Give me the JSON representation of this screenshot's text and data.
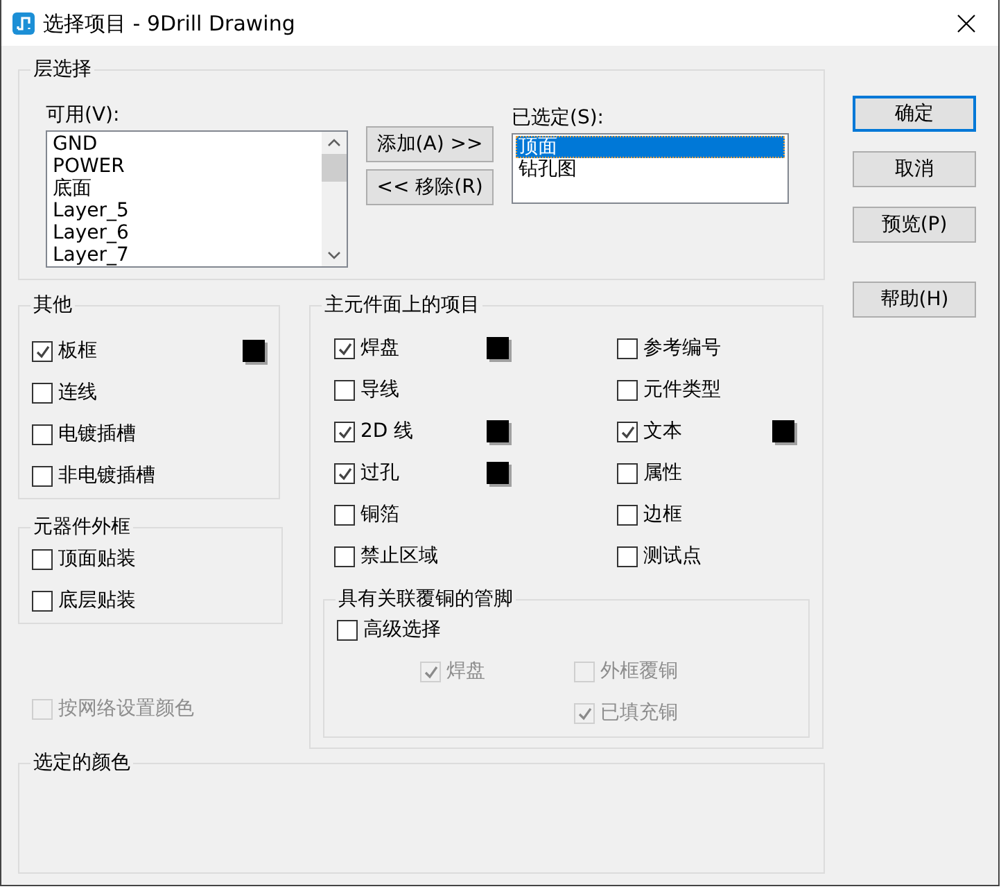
{
  "window": {
    "title": "选择项目 - 9Drill Drawing"
  },
  "layer_selection": {
    "title": "层选择",
    "available": {
      "label": "可用(V):",
      "items": [
        {
          "label": "GND",
          "selected": false
        },
        {
          "label": "POWER",
          "selected": false
        },
        {
          "label": "底面",
          "selected": false
        },
        {
          "label": "Layer_5",
          "selected": false
        },
        {
          "label": "Layer_6",
          "selected": false
        },
        {
          "label": "Layer_7",
          "selected": false
        }
      ]
    },
    "move_buttons": [
      {
        "label": "添加(A) >>"
      },
      {
        "label": "<< 移除(R)"
      }
    ],
    "selected": {
      "label": "已选定(S):",
      "items": [
        {
          "label": "顶面",
          "selected": true
        },
        {
          "label": "钻孔图",
          "selected": false
        }
      ]
    }
  },
  "other": {
    "title": "其他",
    "items": [
      {
        "label": "板框",
        "checked": true,
        "color": "#000000"
      },
      {
        "label": "连线",
        "checked": false
      },
      {
        "label": "电镀插槽",
        "checked": false
      },
      {
        "label": "非电镀插槽",
        "checked": false
      }
    ]
  },
  "component_outline": {
    "title": "元器件外框",
    "items": [
      {
        "label": "顶面贴装",
        "checked": false
      },
      {
        "label": "底层贴装",
        "checked": false
      }
    ]
  },
  "net_color": {
    "label": "按网络设置颜色",
    "checked": false,
    "disabled": true
  },
  "primary_side": {
    "title": "主元件面上的项目",
    "columns": [
      {
        "items": [
          {
            "label": "焊盘",
            "checked": true,
            "color": "#000000"
          },
          {
            "label": "导线",
            "checked": false
          },
          {
            "label": "2D 线",
            "checked": true,
            "color": "#000000"
          },
          {
            "label": "过孔",
            "checked": true,
            "color": "#000000"
          },
          {
            "label": "铜箔",
            "checked": false
          },
          {
            "label": "禁止区域",
            "checked": false
          }
        ]
      },
      {
        "items": [
          {
            "label": "参考编号",
            "checked": false
          },
          {
            "label": "元件类型",
            "checked": false
          },
          {
            "label": "文本",
            "checked": true,
            "color": "#000000"
          },
          {
            "label": "属性",
            "checked": false
          },
          {
            "label": "边框",
            "checked": false
          },
          {
            "label": "测试点",
            "checked": false
          }
        ]
      }
    ],
    "pins": {
      "title": "具有关联覆铜的管脚",
      "advanced": {
        "label": "高级选择",
        "checked": false,
        "disabled": false
      },
      "option_columns": [
        {
          "items": [
            {
              "label": "焊盘",
              "checked": true,
              "disabled": true
            }
          ]
        },
        {
          "items": [
            {
              "label": "外框覆铜",
              "checked": false,
              "disabled": true
            },
            {
              "label": "已填充铜",
              "checked": true,
              "disabled": true
            }
          ]
        }
      ]
    }
  },
  "selected_color": {
    "title": "选定的颜色"
  },
  "buttons": [
    {
      "label": "确定",
      "default": true
    },
    {
      "label": "取消",
      "default": false
    },
    {
      "label": "预览(P)",
      "default": false
    },
    {
      "label": "帮助(H)",
      "default": false
    }
  ]
}
